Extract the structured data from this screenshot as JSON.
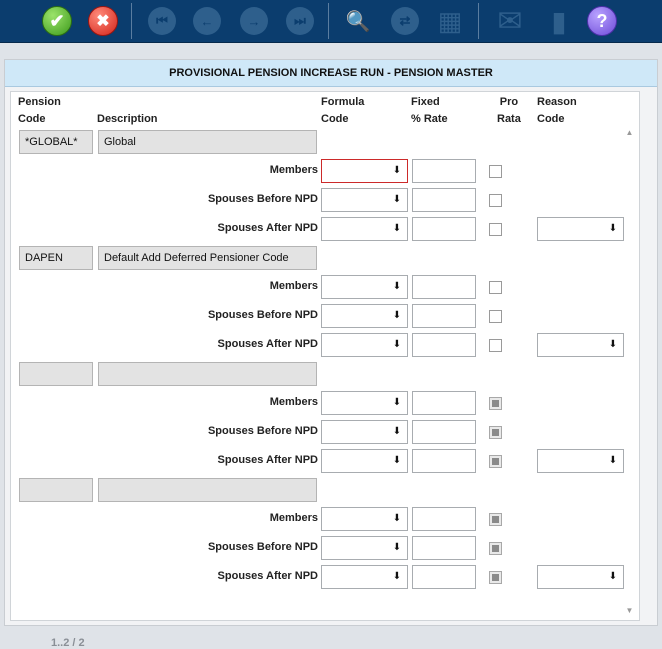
{
  "toolbar": {
    "buttons": [
      {
        "icon": "check-icon",
        "glyph": "✔"
      },
      {
        "icon": "cancel-icon",
        "glyph": "✖"
      },
      {
        "icon": "first-record-icon",
        "glyph": "⏮"
      },
      {
        "icon": "previous-record-icon",
        "glyph": "←"
      },
      {
        "icon": "next-record-icon",
        "glyph": "→"
      },
      {
        "icon": "last-record-icon",
        "glyph": "⏭"
      },
      {
        "icon": "search-icon",
        "glyph": "🔍"
      },
      {
        "icon": "refresh-icon",
        "glyph": "⇄"
      },
      {
        "icon": "notepad-icon",
        "glyph": "▦"
      },
      {
        "icon": "mail-icon",
        "glyph": "✉"
      },
      {
        "icon": "book-icon",
        "glyph": "▮"
      },
      {
        "icon": "help-icon",
        "glyph": "?"
      }
    ]
  },
  "title": "PROVISIONAL PENSION INCREASE RUN - PENSION MASTER",
  "headers": {
    "pension_code": [
      "Pension",
      "Code"
    ],
    "description": [
      "Description"
    ],
    "formula_code": [
      "Formula",
      "Code"
    ],
    "fixed_rate": [
      "Fixed",
      "% Rate"
    ],
    "pro_rata": [
      "Pro",
      "Rata"
    ],
    "reason_code": [
      "Reason",
      "Code"
    ]
  },
  "groups": [
    {
      "code": "*GLOBAL*",
      "description": "Global",
      "rows": [
        {
          "label": "Members",
          "formula": "",
          "rate": "",
          "pro_rata_disabled": false,
          "has_reason": false,
          "error": true
        },
        {
          "label": "Spouses Before NPD",
          "formula": "",
          "rate": "",
          "pro_rata_disabled": false,
          "has_reason": false
        },
        {
          "label": "Spouses After NPD",
          "formula": "",
          "rate": "",
          "pro_rata_disabled": false,
          "has_reason": true
        }
      ]
    },
    {
      "code": "DAPEN",
      "description": "Default Add Deferred Pensioner Code",
      "rows": [
        {
          "label": "Members",
          "formula": "",
          "rate": "",
          "pro_rata_disabled": false,
          "has_reason": false
        },
        {
          "label": "Spouses Before NPD",
          "formula": "",
          "rate": "",
          "pro_rata_disabled": false,
          "has_reason": false
        },
        {
          "label": "Spouses After NPD",
          "formula": "",
          "rate": "",
          "pro_rata_disabled": false,
          "has_reason": true
        }
      ]
    },
    {
      "code": "",
      "description": "",
      "rows": [
        {
          "label": "Members",
          "formula": "",
          "rate": "",
          "pro_rata_disabled": true,
          "has_reason": false
        },
        {
          "label": "Spouses Before NPD",
          "formula": "",
          "rate": "",
          "pro_rata_disabled": true,
          "has_reason": false
        },
        {
          "label": "Spouses After NPD",
          "formula": "",
          "rate": "",
          "pro_rata_disabled": true,
          "has_reason": true
        }
      ]
    },
    {
      "code": "",
      "description": "",
      "rows": [
        {
          "label": "Members",
          "formula": "",
          "rate": "",
          "pro_rata_disabled": true,
          "has_reason": false
        },
        {
          "label": "Spouses Before NPD",
          "formula": "",
          "rate": "",
          "pro_rata_disabled": true,
          "has_reason": false
        },
        {
          "label": "Spouses After NPD",
          "formula": "",
          "rate": "",
          "pro_rata_disabled": true,
          "has_reason": true
        }
      ]
    }
  ],
  "pager": "1..2 / 2",
  "dropdown_glyph": "⬇"
}
